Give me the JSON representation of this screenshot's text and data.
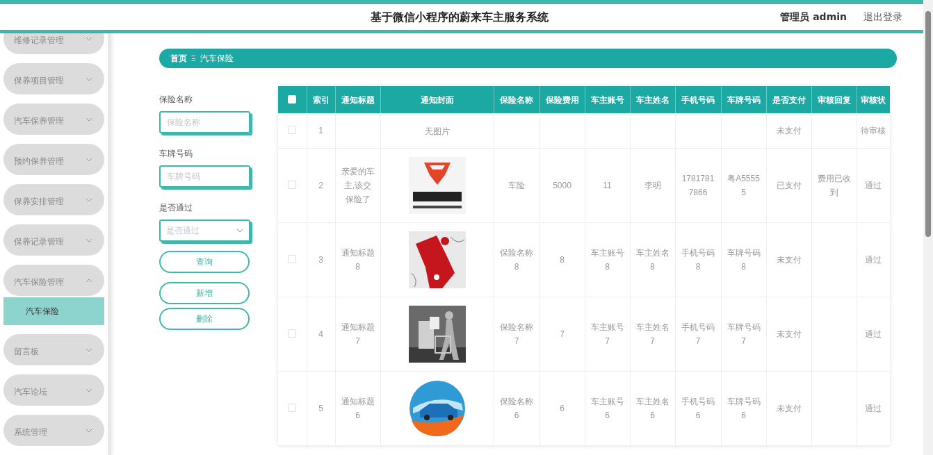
{
  "header": {
    "title": "基于微信小程序的蔚来车主服务系统",
    "user": "管理员 admin",
    "logout": "退出登录"
  },
  "sidebar": {
    "items": [
      {
        "label": "维修记录管理",
        "expanded": false
      },
      {
        "label": "保养项目管理",
        "expanded": false
      },
      {
        "label": "汽车保养管理",
        "expanded": false
      },
      {
        "label": "预约保养管理",
        "expanded": false
      },
      {
        "label": "保养安排管理",
        "expanded": false
      },
      {
        "label": "保养记录管理",
        "expanded": false
      },
      {
        "label": "汽车保险管理",
        "expanded": true,
        "children": [
          {
            "label": "汽车保险",
            "selected": true
          }
        ]
      },
      {
        "label": "留言板",
        "expanded": false
      },
      {
        "label": "汽车论坛",
        "expanded": false
      },
      {
        "label": "系统管理",
        "expanded": false
      }
    ]
  },
  "breadcrumb": {
    "home": "首页",
    "separator": "Ξ",
    "current": "汽车保险"
  },
  "filters": [
    {
      "kind": "input",
      "label": "保险名称",
      "placeholder": "保险名称"
    },
    {
      "kind": "input",
      "label": "车牌号码",
      "placeholder": "车牌号码"
    },
    {
      "kind": "select",
      "label": "是否通过",
      "placeholder": "是否通过"
    }
  ],
  "buttons": [
    {
      "label": "查询"
    },
    {
      "label": "新增"
    },
    {
      "label": "删除"
    }
  ],
  "table": {
    "select_all": {
      "checked": false
    },
    "columns": [
      "索引",
      "通知标题",
      "通知封面",
      "保险名称",
      "保险费用",
      "车主账号",
      "车主姓名",
      "手机号码",
      "车牌号码",
      "是否支付",
      "审核回复",
      "审核状"
    ],
    "rows": [
      {
        "checked": false,
        "cells": [
          "1",
          "",
          {
            "kind": "text",
            "text": "无图片"
          },
          "",
          "",
          "",
          "",
          "",
          "",
          "未支付",
          "",
          "待审核"
        ]
      },
      {
        "checked": false,
        "cells": [
          "2",
          "亲爱的车主,该交保险了",
          {
            "kind": "picture"
          },
          "车险",
          "5000",
          "11",
          "李明",
          "17817817866",
          "粤A55555",
          "已支付",
          "费用已收到",
          "通过"
        ]
      },
      {
        "checked": false,
        "cells": [
          "3",
          "通知标题8",
          {
            "kind": "picture"
          },
          "保险名称8",
          "8",
          "车主账号8",
          "车主姓名8",
          "手机号码8",
          "车牌号码8",
          "未支付",
          "",
          "通过"
        ]
      },
      {
        "checked": false,
        "cells": [
          "4",
          "通知标题7",
          {
            "kind": "picture"
          },
          "保险名称7",
          "7",
          "车主账号7",
          "车主姓名7",
          "手机号码7",
          "车牌号码7",
          "未支付",
          "",
          "通过"
        ]
      },
      {
        "checked": false,
        "cells": [
          "5",
          "通知标题6",
          {
            "kind": "picture"
          },
          "保险名称6",
          "6",
          "车主账号6",
          "车主姓名6",
          "手机号码6",
          "车牌号码6",
          "未支付",
          "",
          "通过"
        ]
      }
    ]
  }
}
